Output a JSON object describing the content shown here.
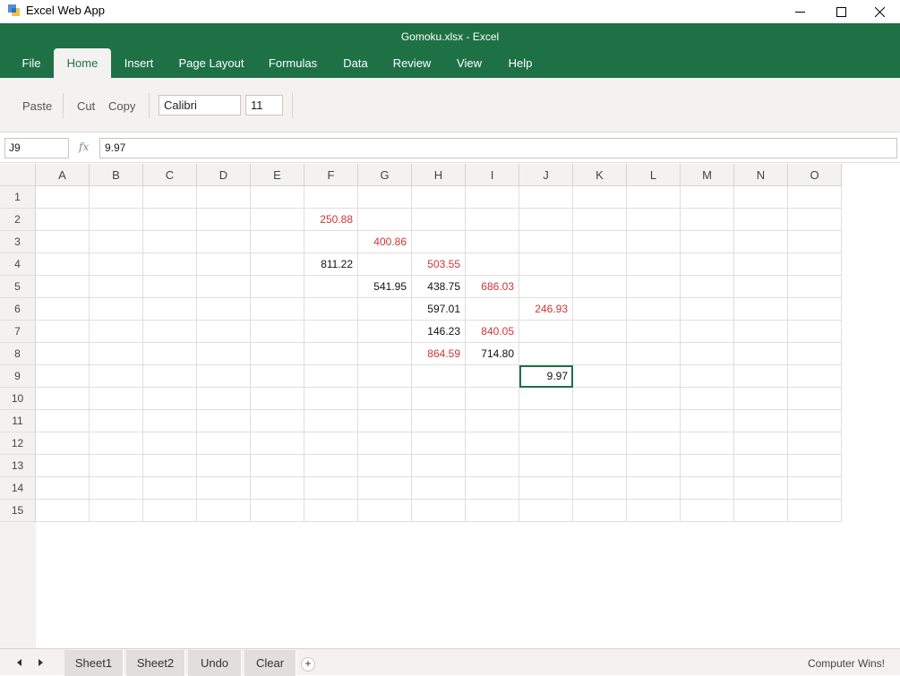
{
  "window": {
    "app_title": "Excel Web App",
    "doc_title": "Gomoku.xlsx - Excel"
  },
  "tabs": [
    {
      "label": "File",
      "active": false
    },
    {
      "label": "Home",
      "active": true
    },
    {
      "label": "Insert",
      "active": false
    },
    {
      "label": "Page Layout",
      "active": false
    },
    {
      "label": "Formulas",
      "active": false
    },
    {
      "label": "Data",
      "active": false
    },
    {
      "label": "Review",
      "active": false
    },
    {
      "label": "View",
      "active": false
    },
    {
      "label": "Help",
      "active": false
    }
  ],
  "ribbon": {
    "paste_label": "Paste",
    "cut_label": "Cut",
    "copy_label": "Copy",
    "font_name": "Calibri",
    "font_size": "11"
  },
  "formula_bar": {
    "name_box": "J9",
    "fx_label": "fx",
    "value": "9.97"
  },
  "columns": [
    "A",
    "B",
    "C",
    "D",
    "E",
    "F",
    "G",
    "H",
    "I",
    "J",
    "K",
    "L",
    "M",
    "N",
    "O"
  ],
  "rows": [
    "1",
    "2",
    "3",
    "4",
    "5",
    "6",
    "7",
    "8",
    "9",
    "10",
    "11",
    "12",
    "13",
    "14",
    "15"
  ],
  "cells": [
    {
      "ref": "F2",
      "value": "250.88",
      "color": "red"
    },
    {
      "ref": "G3",
      "value": "400.86",
      "color": "red"
    },
    {
      "ref": "F4",
      "value": "811.22",
      "color": "black"
    },
    {
      "ref": "H4",
      "value": "503.55",
      "color": "red"
    },
    {
      "ref": "G5",
      "value": "541.95",
      "color": "black"
    },
    {
      "ref": "H5",
      "value": "438.75",
      "color": "black"
    },
    {
      "ref": "I5",
      "value": "686.03",
      "color": "red"
    },
    {
      "ref": "H6",
      "value": "597.01",
      "color": "black"
    },
    {
      "ref": "J6",
      "value": "246.93",
      "color": "red"
    },
    {
      "ref": "H7",
      "value": "146.23",
      "color": "black"
    },
    {
      "ref": "I7",
      "value": "840.05",
      "color": "red"
    },
    {
      "ref": "H8",
      "value": "864.59",
      "color": "red"
    },
    {
      "ref": "I8",
      "value": "714.80",
      "color": "black"
    },
    {
      "ref": "J9",
      "value": "9.97",
      "color": "black",
      "selected": true
    }
  ],
  "colors": {
    "header_green": "#1e7145",
    "value_red": "#d13438",
    "selection_green": "#1e7145"
  },
  "sheet_tabs": [
    {
      "label": "Sheet1"
    },
    {
      "label": "Sheet2"
    },
    {
      "label": "Undo"
    },
    {
      "label": "Clear"
    }
  ],
  "add_sheet_label": "+",
  "status": "Computer Wins!"
}
